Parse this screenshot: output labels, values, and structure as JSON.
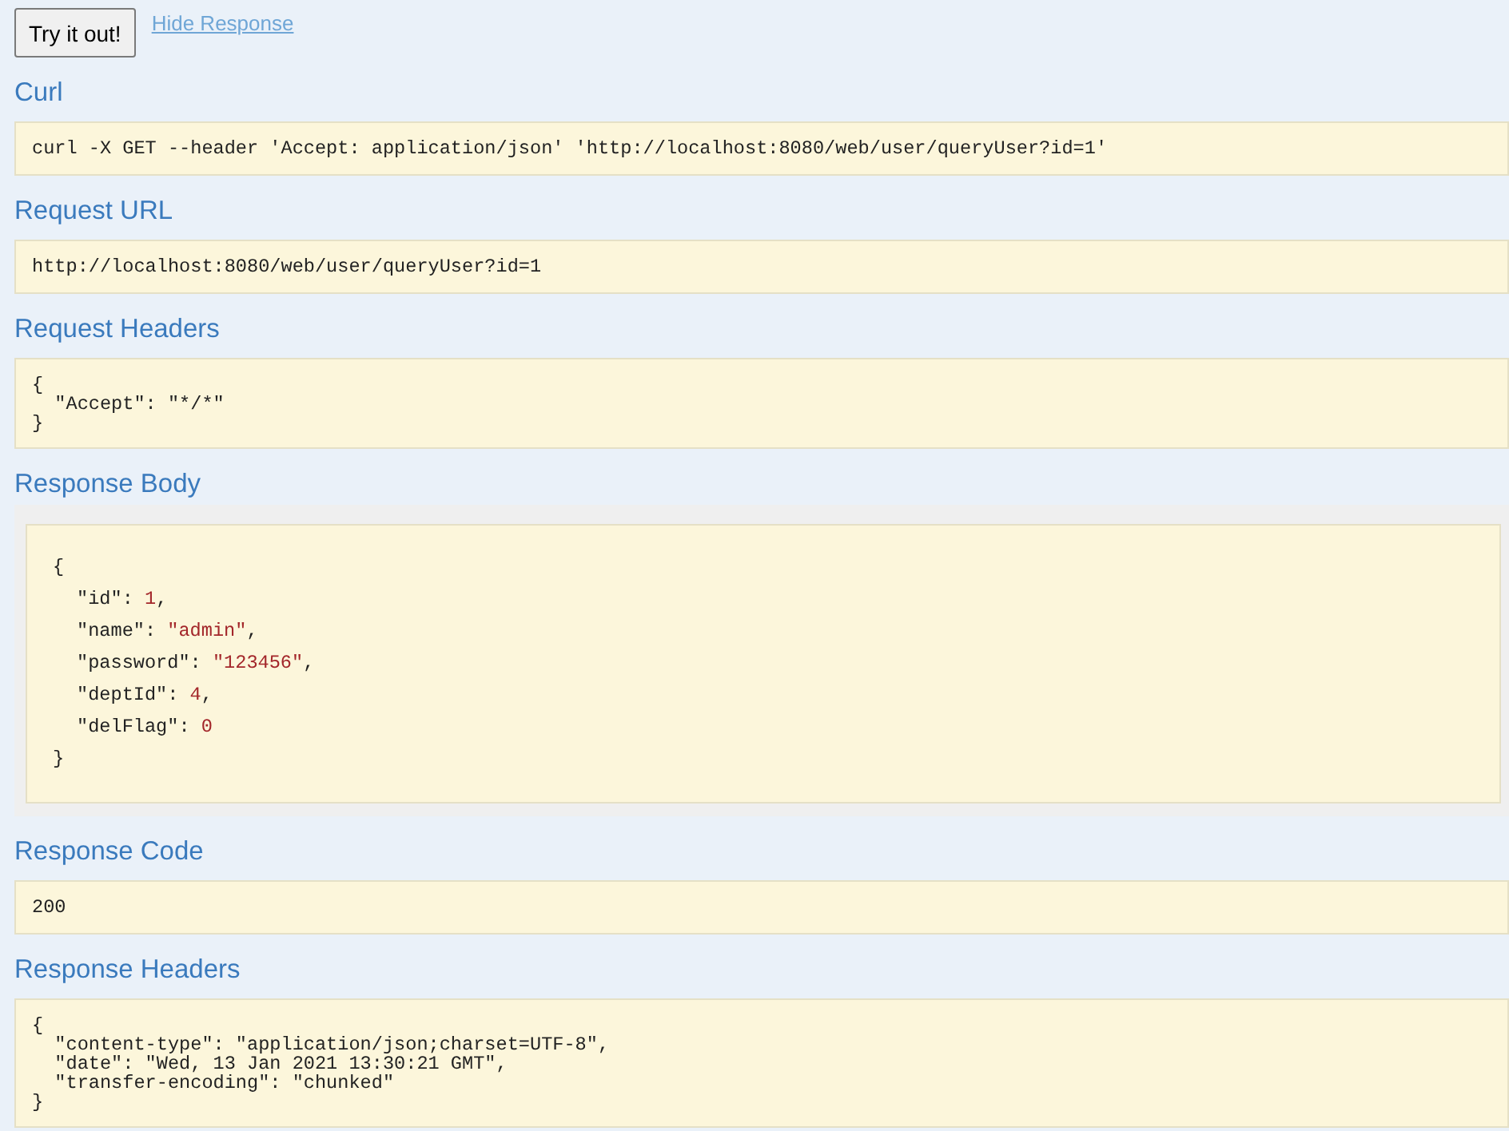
{
  "actions": {
    "try_button": "Try it out!",
    "hide_link": "Hide Response"
  },
  "sections": [
    {
      "kind": "code",
      "title": "Curl",
      "lines": [
        "curl -X GET --header 'Accept: application/json' 'http://localhost:8080/web/user/queryUser?id=1'"
      ]
    },
    {
      "kind": "code",
      "title": "Request URL",
      "lines": [
        "http://localhost:8080/web/user/queryUser?id=1"
      ]
    },
    {
      "kind": "code",
      "title": "Request Headers",
      "lines": [
        "{",
        "  \"Accept\": \"*/*\"",
        "}"
      ]
    },
    {
      "kind": "json",
      "title": "Response Body",
      "open": "{",
      "entries": [
        {
          "key": "\"id\":",
          "value": "1",
          "end": ","
        },
        {
          "key": "\"name\":",
          "value": "\"admin\"",
          "end": ","
        },
        {
          "key": "\"password\":",
          "value": "\"123456\"",
          "end": ","
        },
        {
          "key": "\"deptId\":",
          "value": "4",
          "end": ","
        },
        {
          "key": "\"delFlag\":",
          "value": "0"
        }
      ],
      "close": "}"
    },
    {
      "kind": "code",
      "title": "Response Code",
      "lines": [
        "200"
      ]
    },
    {
      "kind": "code",
      "title": "Response Headers",
      "lines": [
        "{",
        "  \"content-type\": \"application/json;charset=UTF-8\",",
        "  \"date\": \"Wed, 13 Jan 2021 13:30:21 GMT\",",
        "  \"transfer-encoding\": \"chunked\"",
        "}"
      ]
    }
  ]
}
